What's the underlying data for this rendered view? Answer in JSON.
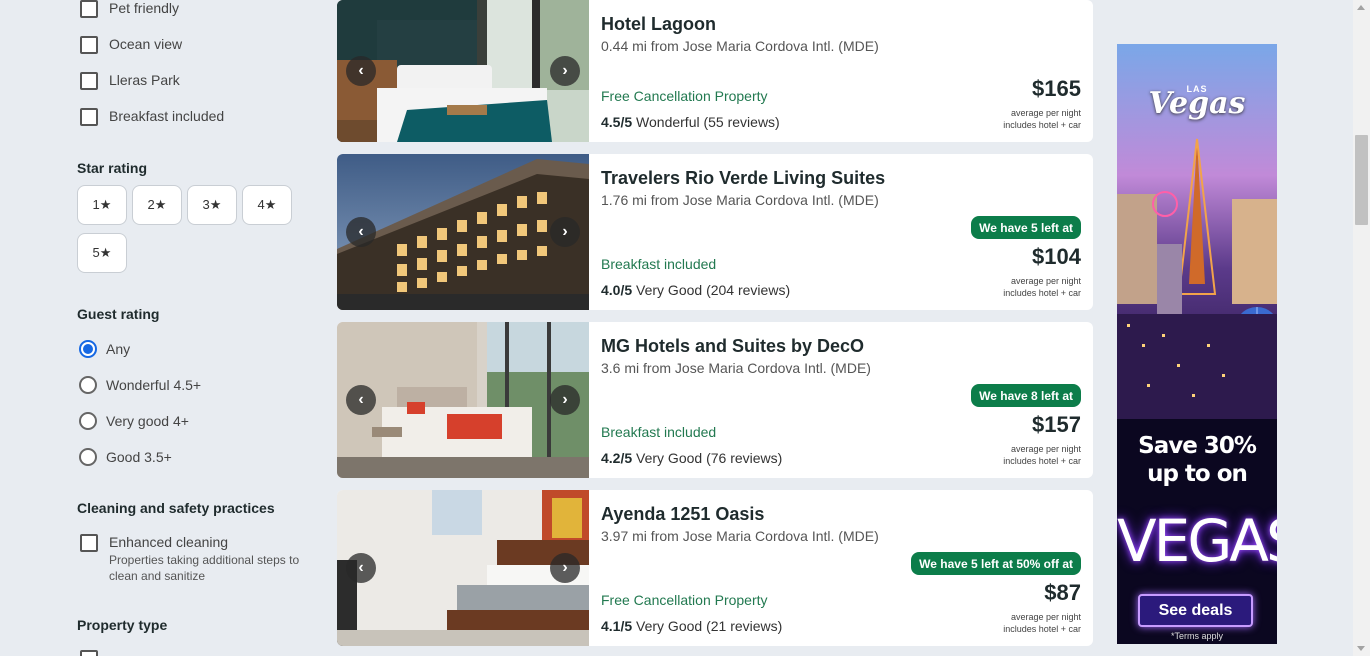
{
  "filters": {
    "amenities": [
      {
        "label": "Pet friendly"
      },
      {
        "label": "Ocean view"
      },
      {
        "label": "Lleras Park"
      },
      {
        "label": "Breakfast included"
      }
    ],
    "star_rating": {
      "title": "Star rating",
      "options": [
        "1★",
        "2★",
        "3★",
        "4★",
        "5★"
      ]
    },
    "guest_rating": {
      "title": "Guest rating",
      "options": [
        {
          "label": "Any",
          "selected": true
        },
        {
          "label": "Wonderful 4.5+",
          "selected": false
        },
        {
          "label": "Very good 4+",
          "selected": false
        },
        {
          "label": "Good 3.5+",
          "selected": false
        }
      ]
    },
    "cleaning": {
      "title": "Cleaning and safety practices",
      "option_label": "Enhanced cleaning",
      "option_desc_1": "Properties taking additional steps to",
      "option_desc_2": "clean and sanitize"
    },
    "property_type": {
      "title": "Property type"
    }
  },
  "hotels": [
    {
      "name": "Hotel Lagoon",
      "distance": "0.44 mi from Jose Maria Cordova Intl. (MDE)",
      "feature": "Free Cancellation Property",
      "rating_score": "4.5/5",
      "rating_text": "Wonderful (55 reviews)",
      "badge": "",
      "price": "$165",
      "price_note_1": "average per night",
      "price_note_2": "includes hotel + car"
    },
    {
      "name": "Travelers Rio Verde Living Suites",
      "distance": "1.76 mi from Jose Maria Cordova Intl. (MDE)",
      "feature": "Breakfast included",
      "rating_score": "4.0/5",
      "rating_text": "Very Good (204 reviews)",
      "badge": "We have 5 left at",
      "price": "$104",
      "price_note_1": "average per night",
      "price_note_2": "includes hotel + car"
    },
    {
      "name": "MG Hotels and Suites by DecO",
      "distance": "3.6 mi from Jose Maria Cordova Intl. (MDE)",
      "feature": "Breakfast included",
      "rating_score": "4.2/5",
      "rating_text": "Very Good (76 reviews)",
      "badge": "We have 8 left at",
      "price": "$157",
      "price_note_1": "average per night",
      "price_note_2": "includes hotel + car"
    },
    {
      "name": "Ayenda 1251 Oasis",
      "distance": "3.97 mi from Jose Maria Cordova Intl. (MDE)",
      "feature": "Free Cancellation Property",
      "rating_score": "4.1/5",
      "rating_text": "Very Good (21 reviews)",
      "badge": "We have 5 left at 50% off at",
      "price": "$87",
      "price_note_1": "average per night",
      "price_note_2": "includes hotel + car"
    }
  ],
  "ad": {
    "logo_small": "LAS",
    "logo": "Vegas",
    "save_line_1": "Save 30%",
    "save_line_2": "up to on",
    "vegas": "VEGAS",
    "cta": "See deals",
    "terms": "*Terms apply"
  },
  "nav": {
    "prev": "‹",
    "next": "›"
  }
}
